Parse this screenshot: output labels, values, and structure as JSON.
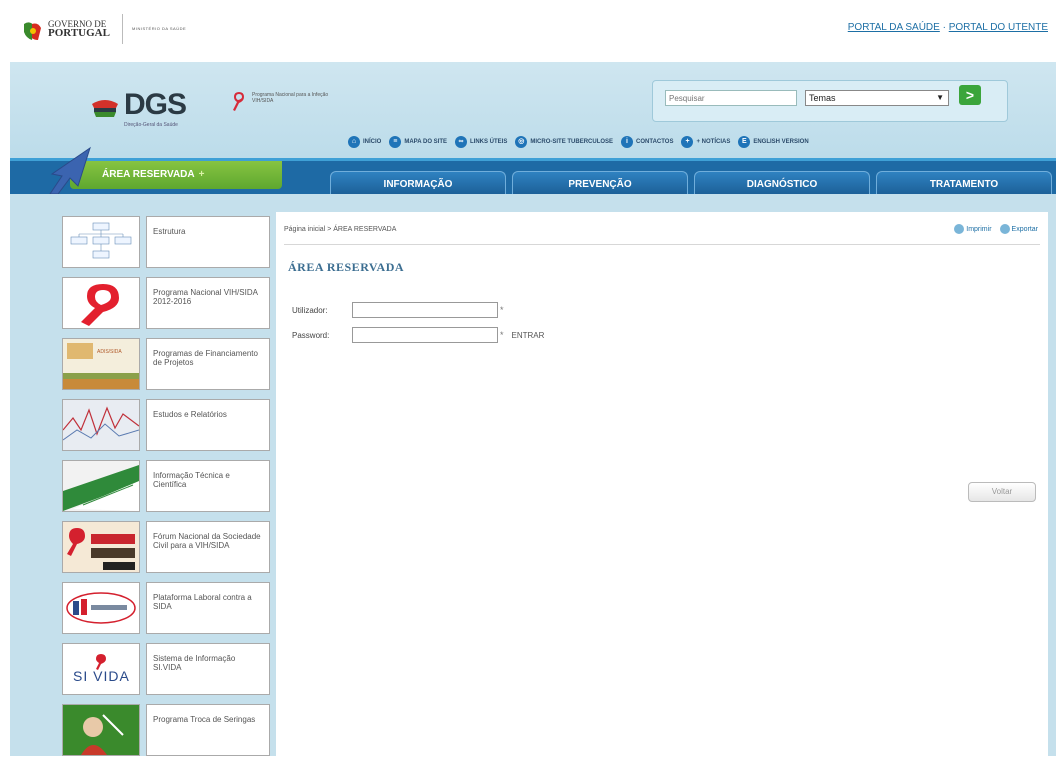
{
  "gov": {
    "name_line1": "GOVERNO DE",
    "name_line2": "PORTUGAL",
    "ministry": "MINISTÉRIO DA SAÚDE"
  },
  "portal_links": {
    "saude": "PORTAL DA SAÚDE",
    "sep": " · ",
    "utente": "PORTAL DO UTENTE"
  },
  "logo": {
    "name": "DGS",
    "subtitle": "Direção-Geral da Saúde",
    "programa": "Programa Nacional para a Infeção VIH/SIDA"
  },
  "search": {
    "placeholder": "Pesquisar",
    "selected": "Temas",
    "go": ">"
  },
  "topnav": [
    {
      "label": "INÍCIO"
    },
    {
      "label": "MAPA DO SITE"
    },
    {
      "label": "LINKS ÚTEIS"
    },
    {
      "label": "MICRO-SITE TUBERCULOSE"
    },
    {
      "label": "CONTACTOS"
    },
    {
      "label": "+ NOTÍCIAS"
    },
    {
      "label": "ENGLISH VERSION"
    }
  ],
  "nav": {
    "area_reservada": "ÁREA RESERVADA",
    "plus": "+",
    "tabs": [
      "INFORMAÇÃO",
      "PREVENÇÃO",
      "DIAGNÓSTICO",
      "TRATAMENTO"
    ]
  },
  "sidebar": [
    {
      "label": "Estrutura"
    },
    {
      "label": "Programa Nacional VIH/SIDA 2012-2016"
    },
    {
      "label": "Programas de Financiamento de Projetos"
    },
    {
      "label": "Estudos e Relatórios"
    },
    {
      "label": "Informação Técnica e Científica"
    },
    {
      "label": "Fórum Nacional da Sociedade Civil para a VIH/SIDA"
    },
    {
      "label": "Plataforma Laboral contra a SIDA"
    },
    {
      "label": "Sistema de Informação SI.VIDA"
    },
    {
      "label": "Programa Troca de Seringas"
    }
  ],
  "sivida_logo": "SI VIDA",
  "main": {
    "breadcrumb": "Página inicial > ÁREA RESERVADA",
    "print": "Imprimir",
    "export": "Exportar",
    "title": "ÁREA RESERVADA",
    "user_label": "Utilizador:",
    "password_label": "Password:",
    "required": "*",
    "enter": "ENTRAR",
    "back": "Voltar"
  },
  "colors": {
    "navbar": "#1e6aa5",
    "area_reservada": "#6db33a",
    "frame_bg": "#c5e0ec"
  }
}
